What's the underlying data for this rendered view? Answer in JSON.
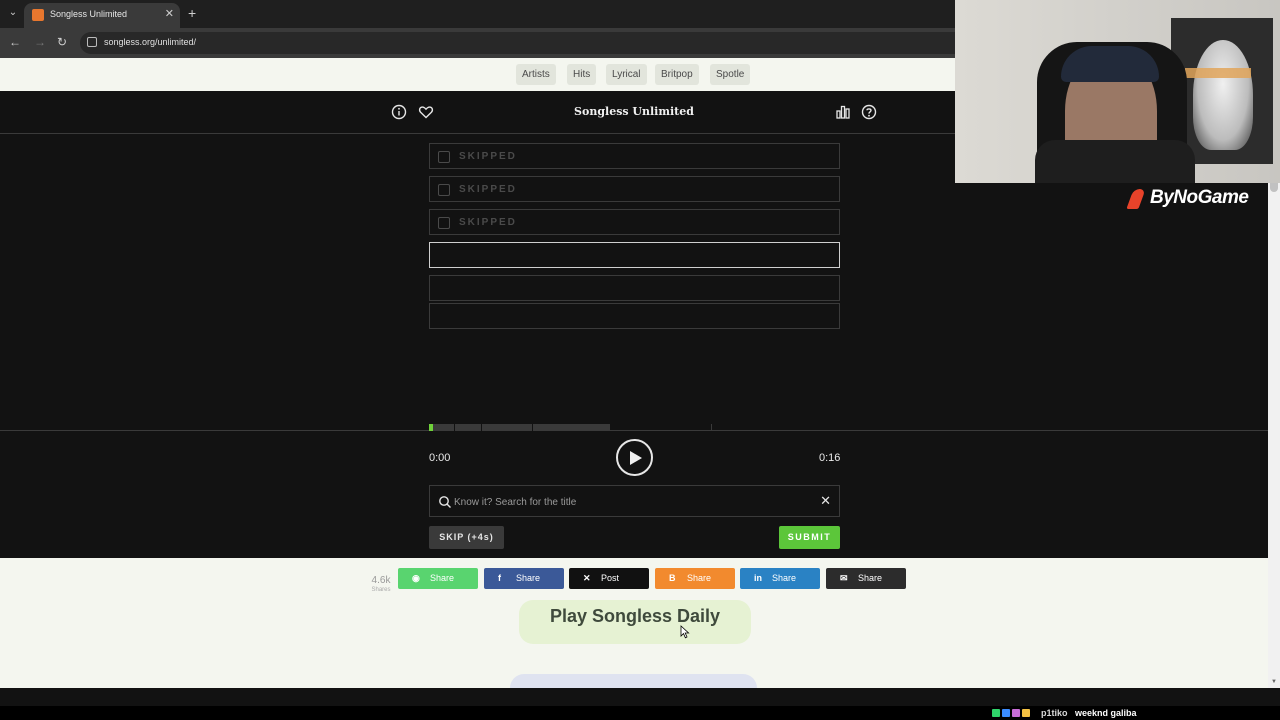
{
  "browser": {
    "tab_title": "Songless Unlimited",
    "url": "songless.org/unlimited/"
  },
  "site_nav": {
    "items": [
      "Artists",
      "Hits",
      "Lyrical",
      "Britpop",
      "Spotle"
    ]
  },
  "header": {
    "title": "Songless Unlimited",
    "icons": [
      "info-icon",
      "heart-icon",
      "bar-chart-icon",
      "help-icon"
    ]
  },
  "guesses": [
    {
      "label": "SKIPPED",
      "state": "skipped"
    },
    {
      "label": "SKIPPED",
      "state": "skipped"
    },
    {
      "label": "SKIPPED",
      "state": "skipped"
    },
    {
      "label": "",
      "state": "active"
    },
    {
      "label": "",
      "state": "empty"
    },
    {
      "label": "",
      "state": "empty"
    }
  ],
  "player": {
    "current_time": "0:00",
    "total_time": "0:16",
    "played_fraction": 0.01,
    "unlocked_fraction": 0.44,
    "accent_color": "#6fd13a"
  },
  "search": {
    "placeholder": "Know it? Search for the title",
    "value": ""
  },
  "buttons": {
    "skip": "SKIP (+4s)",
    "submit": "SUBMIT",
    "submit_color": "#5cc63a"
  },
  "share": {
    "count": "4.6k",
    "count_label": "Shares",
    "buttons": [
      {
        "label": "Share",
        "icon": "whatsapp-icon",
        "glyph": "◉",
        "color": "#59d46f"
      },
      {
        "label": "Share",
        "icon": "facebook-icon",
        "glyph": "f",
        "color": "#3b5998"
      },
      {
        "label": "Post",
        "icon": "x-icon",
        "glyph": "✕",
        "color": "#111111"
      },
      {
        "label": "Share",
        "icon": "blogger-icon",
        "glyph": "B",
        "color": "#f28a2e"
      },
      {
        "label": "Share",
        "icon": "linkedin-icon",
        "glyph": "in",
        "color": "#2a82c4"
      },
      {
        "label": "Share",
        "icon": "messenger-icon",
        "glyph": "✉",
        "color": "#2c2c2c"
      }
    ]
  },
  "cta": {
    "label": "Play Songless Daily"
  },
  "overlay": {
    "logo_text": "ByNoGame",
    "chat_user": "p1tiko",
    "chat_message": "weeknd galiba"
  }
}
